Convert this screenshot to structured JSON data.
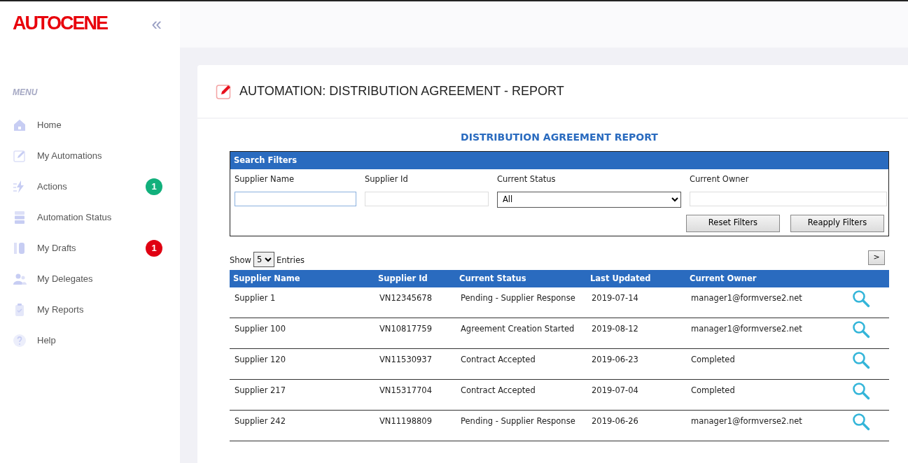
{
  "sidebar": {
    "logo": "AUTOCENE",
    "collapse_button": "«",
    "menu_label": "MENU",
    "items": [
      {
        "label": "Home"
      },
      {
        "label": "My Automations"
      },
      {
        "label": "Actions",
        "badge": {
          "text": "1",
          "color": "#12b07c"
        }
      },
      {
        "label": "Automation Status"
      },
      {
        "label": "My Drafts",
        "badge": {
          "text": "1",
          "color": "#e00012"
        }
      },
      {
        "label": "My Delegates"
      },
      {
        "label": "My Reports"
      },
      {
        "label": "Help"
      }
    ]
  },
  "page": {
    "title": "AUTOMATION: DISTRIBUTION AGREEMENT - REPORT"
  },
  "report": {
    "title": "DISTRIBUTION AGREEMENT REPORT",
    "filters": {
      "title": "Search Filters",
      "fields": [
        {
          "label": "Supplier Name",
          "kind": "text",
          "focused": true
        },
        {
          "label": "Supplier Id",
          "kind": "text",
          "focused": false
        },
        {
          "label": "Current Status",
          "kind": "select",
          "value": "All",
          "focused": false
        },
        {
          "label": "Current Owner",
          "kind": "text",
          "focused": false
        }
      ],
      "buttons": [
        "Reset Filters",
        "Reapply Filters"
      ]
    },
    "show_label": "Show",
    "page_size": "5",
    "entries_label": "Entries",
    "next_button": ">",
    "table": {
      "columns": [
        "Supplier Name",
        "Supplier Id",
        "Current Status",
        "Last Updated",
        "Current Owner"
      ],
      "rows": [
        [
          "Supplier 1",
          "VN12345678",
          "Pending - Supplier Response",
          "2019-07-14",
          "manager1@formverse2.net"
        ],
        [
          "Supplier 100",
          "VN10817759",
          "Agreement Creation Started",
          "2019-08-12",
          "manager1@formverse2.net"
        ],
        [
          "Supplier 120",
          "VN11530937",
          "Contract Accepted",
          "2019-06-23",
          "Completed"
        ],
        [
          "Supplier 217",
          "VN15317704",
          "Contract Accepted",
          "2019-07-04",
          "Completed"
        ],
        [
          "Supplier 242",
          "VN11198809",
          "Pending - Supplier Response",
          "2019-06-26",
          "manager1@formverse2.net"
        ]
      ]
    }
  }
}
